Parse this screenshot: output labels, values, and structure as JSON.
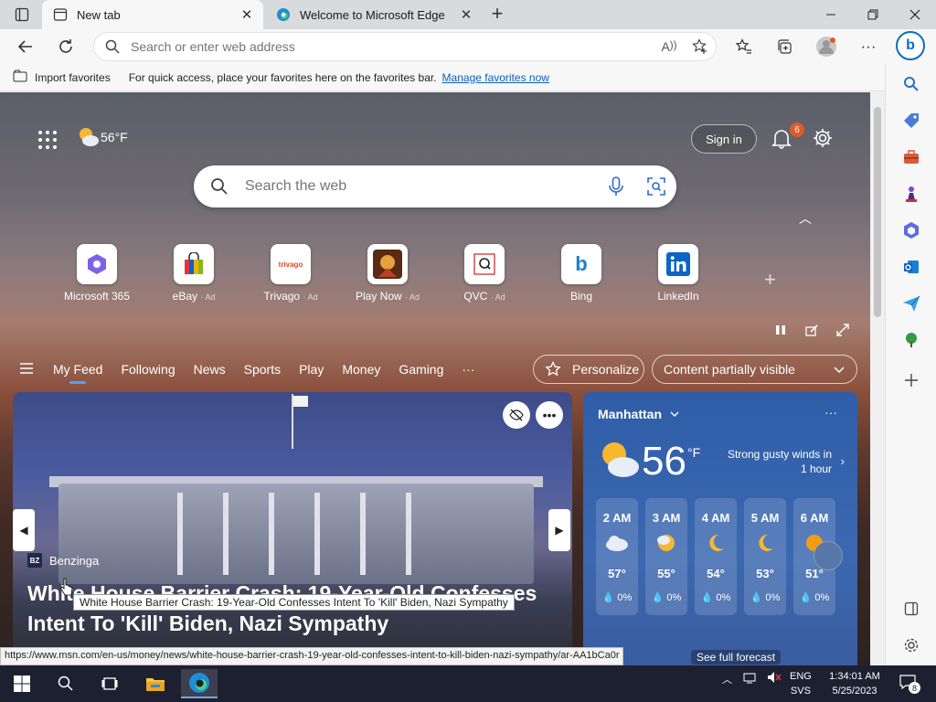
{
  "browser": {
    "tabs": [
      {
        "title": "New tab",
        "close": "✕"
      },
      {
        "title": "Welcome to Microsoft Edge",
        "close": "✕"
      }
    ],
    "new_tab": "+",
    "address_placeholder": "Search or enter web address",
    "favorites_bar": {
      "import": "Import favorites",
      "message": "For quick access, place your favorites here on the favorites bar.",
      "link": "Manage favorites now"
    },
    "status_url": "https://www.msn.com/en-us/money/news/white-house-barrier-crash-19-year-old-confesses-intent-to-kill-biden-nazi-sympathy/ar-AA1bCa0r"
  },
  "newtab": {
    "weather_temp": "56°F",
    "sign_in": "Sign in",
    "notification_count": "6",
    "search_placeholder": "Search the web",
    "tiles": [
      {
        "label": "Microsoft 365",
        "ad": ""
      },
      {
        "label": "eBay",
        "ad": "· Ad"
      },
      {
        "label": "Trivago",
        "ad": "· Ad"
      },
      {
        "label": "Play Now",
        "ad": "· Ad"
      },
      {
        "label": "QVC",
        "ad": "· Ad"
      },
      {
        "label": "Bing",
        "ad": ""
      },
      {
        "label": "LinkedIn",
        "ad": ""
      }
    ],
    "feed_tabs": [
      "My Feed",
      "Following",
      "News",
      "Sports",
      "Play",
      "Money",
      "Gaming"
    ],
    "feed_more": "···",
    "personalize": "Personalize",
    "visibility": "Content partially visible"
  },
  "hero": {
    "source": "Benzinga",
    "source_badge": "BZ",
    "headline": "White House Barrier Crash: 19-Year-Old Confesses Intent To 'Kill' Biden, Nazi Sympathy",
    "tooltip": "White House Barrier Crash: 19-Year-Old Confesses Intent To 'Kill' Biden, Nazi Sympathy"
  },
  "weather": {
    "location": "Manhattan",
    "temp": "56",
    "unit": "°F",
    "alert": "Strong gusty winds in 1 hour",
    "hours": [
      {
        "time": "2 AM",
        "temp": "57°",
        "precip": "0%",
        "icon": "cloud"
      },
      {
        "time": "3 AM",
        "temp": "55°",
        "precip": "0%",
        "icon": "moon-cloud"
      },
      {
        "time": "4 AM",
        "temp": "54°",
        "precip": "0%",
        "icon": "moon"
      },
      {
        "time": "5 AM",
        "temp": "53°",
        "precip": "0%",
        "icon": "moon"
      },
      {
        "time": "6 AM",
        "temp": "51°",
        "precip": "0%",
        "icon": "sun"
      }
    ],
    "forecast_link": "See full forecast"
  },
  "taskbar": {
    "lang_top": "ENG",
    "lang_bottom": "SVS",
    "time": "1:34:01 AM",
    "date": "5/25/2023",
    "notif_count": "8"
  },
  "colors": {
    "accent": "#0f6cbd",
    "link": "#0f5fb9",
    "badge": "#e05a2b"
  }
}
